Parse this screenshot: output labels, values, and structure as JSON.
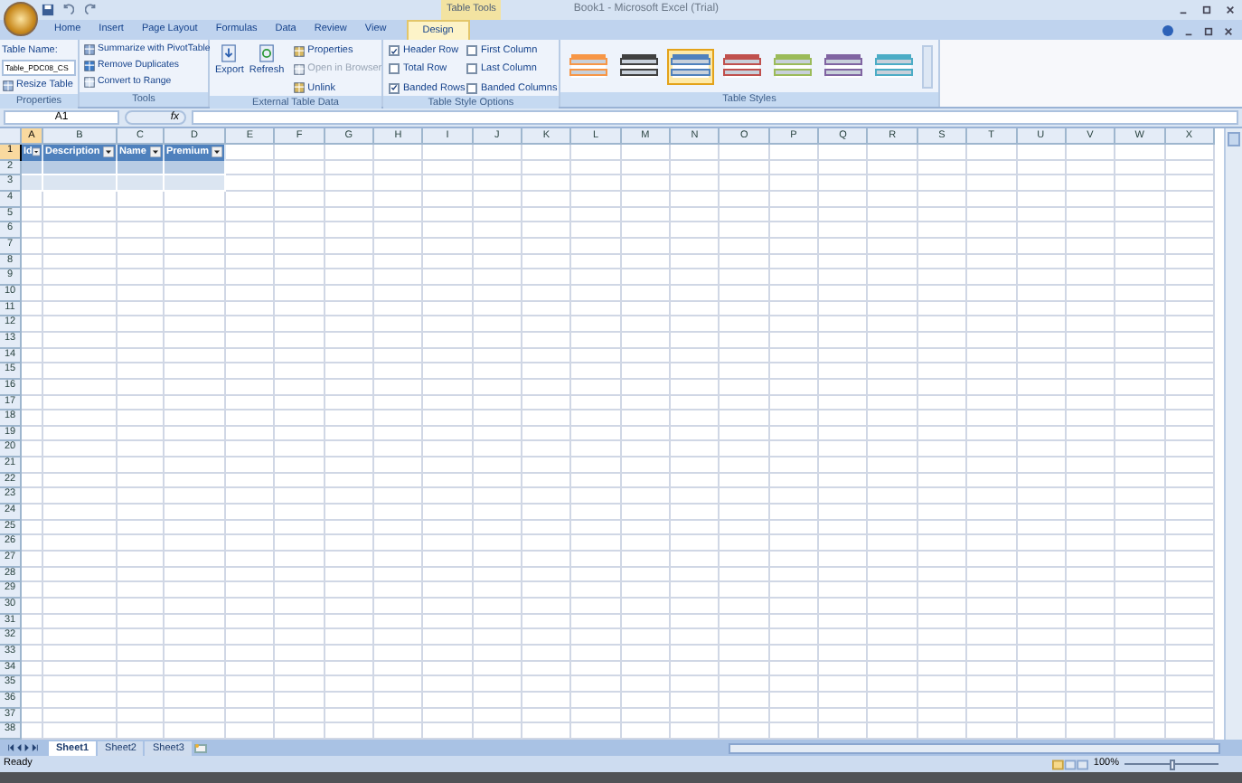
{
  "title_bar": {
    "context_label": "Table Tools",
    "title": "Book1 - Microsoft Excel (Trial)"
  },
  "tabs": [
    {
      "label": "Home",
      "selected": false
    },
    {
      "label": "Insert",
      "selected": false
    },
    {
      "label": "Page Layout",
      "selected": false
    },
    {
      "label": "Formulas",
      "selected": false
    },
    {
      "label": "Data",
      "selected": false
    },
    {
      "label": "Review",
      "selected": false
    },
    {
      "label": "View",
      "selected": false
    },
    {
      "label": "Design",
      "selected": true
    }
  ],
  "ribbon": {
    "properties": {
      "label": "Properties",
      "name_label": "Table Name:",
      "name_value": "Table_PDC08_CS",
      "resize": "Resize Table"
    },
    "tools": {
      "label": "Tools",
      "items": [
        "Summarize with PivotTable",
        "Remove Duplicates",
        "Convert to Range"
      ]
    },
    "external": {
      "label": "External Table Data",
      "large": [
        "Export",
        "Refresh"
      ],
      "items": [
        {
          "label": "Properties",
          "disabled": false
        },
        {
          "label": "Open in Browser",
          "disabled": true
        },
        {
          "label": "Unlink",
          "disabled": false
        }
      ]
    },
    "style_options": {
      "label": "Table Style Options",
      "options": [
        {
          "label": "Header Row",
          "checked": true
        },
        {
          "label": "Total Row",
          "checked": false
        },
        {
          "label": "Banded Rows",
          "checked": true
        },
        {
          "label": "First Column",
          "checked": false
        },
        {
          "label": "Last Column",
          "checked": false
        },
        {
          "label": "Banded Columns",
          "checked": false
        }
      ]
    },
    "table_styles": {
      "label": "Table Styles",
      "styles": [
        {
          "color": "#f79646",
          "selected": false
        },
        {
          "color": "#404040",
          "selected": false
        },
        {
          "color": "#4f81bd",
          "selected": true
        },
        {
          "color": "#c0504d",
          "selected": false
        },
        {
          "color": "#9bbb59",
          "selected": false
        },
        {
          "color": "#8064a2",
          "selected": false
        },
        {
          "color": "#4bacc6",
          "selected": false
        }
      ]
    }
  },
  "formula_bar": {
    "name_box": "A1",
    "function_label": "fx"
  },
  "columns": [
    {
      "label": "A",
      "selected": true
    },
    {
      "label": "B",
      "selected": false
    },
    {
      "label": "C",
      "selected": false
    },
    {
      "label": "D",
      "selected": false
    },
    {
      "label": "E",
      "selected": false
    },
    {
      "label": "F",
      "selected": false
    },
    {
      "label": "G",
      "selected": false
    },
    {
      "label": "H",
      "selected": false
    },
    {
      "label": "I",
      "selected": false
    },
    {
      "label": "J",
      "selected": false
    },
    {
      "label": "K",
      "selected": false
    },
    {
      "label": "L",
      "selected": false
    },
    {
      "label": "M",
      "selected": false
    },
    {
      "label": "N",
      "selected": false
    },
    {
      "label": "O",
      "selected": false
    },
    {
      "label": "P",
      "selected": false
    },
    {
      "label": "Q",
      "selected": false
    },
    {
      "label": "R",
      "selected": false
    },
    {
      "label": "S",
      "selected": false
    },
    {
      "label": "T",
      "selected": false
    },
    {
      "label": "U",
      "selected": false
    },
    {
      "label": "V",
      "selected": false
    },
    {
      "label": "W",
      "selected": false
    },
    {
      "label": "X",
      "selected": false
    }
  ],
  "rows": [
    {
      "label": "1",
      "selected": true
    },
    {
      "label": "2",
      "selected": false
    },
    {
      "label": "3",
      "selected": false
    },
    {
      "label": "4",
      "selected": false
    },
    {
      "label": "5",
      "selected": false
    },
    {
      "label": "6",
      "selected": false
    },
    {
      "label": "7",
      "selected": false
    },
    {
      "label": "8",
      "selected": false
    },
    {
      "label": "9",
      "selected": false
    },
    {
      "label": "10",
      "selected": false
    },
    {
      "label": "11",
      "selected": false
    },
    {
      "label": "12",
      "selected": false
    },
    {
      "label": "13",
      "selected": false
    },
    {
      "label": "14",
      "selected": false
    },
    {
      "label": "15",
      "selected": false
    },
    {
      "label": "16",
      "selected": false
    },
    {
      "label": "17",
      "selected": false
    },
    {
      "label": "18",
      "selected": false
    },
    {
      "label": "19",
      "selected": false
    },
    {
      "label": "20",
      "selected": false
    },
    {
      "label": "21",
      "selected": false
    },
    {
      "label": "22",
      "selected": false
    },
    {
      "label": "23",
      "selected": false
    },
    {
      "label": "24",
      "selected": false
    },
    {
      "label": "25",
      "selected": false
    },
    {
      "label": "26",
      "selected": false
    },
    {
      "label": "27",
      "selected": false
    },
    {
      "label": "28",
      "selected": false
    },
    {
      "label": "29",
      "selected": false
    },
    {
      "label": "30",
      "selected": false
    },
    {
      "label": "31",
      "selected": false
    },
    {
      "label": "32",
      "selected": false
    },
    {
      "label": "33",
      "selected": false
    },
    {
      "label": "34",
      "selected": false
    },
    {
      "label": "35",
      "selected": false
    },
    {
      "label": "36",
      "selected": false
    },
    {
      "label": "37",
      "selected": false
    },
    {
      "label": "38",
      "selected": false
    }
  ],
  "table": {
    "headers": [
      "Id",
      "Description",
      "Name",
      "Premium"
    ],
    "rows": [
      {
        "banded": true
      },
      {
        "banded": false
      }
    ]
  },
  "sheets": [
    {
      "label": "Sheet1",
      "selected": true
    },
    {
      "label": "Sheet2",
      "selected": false
    },
    {
      "label": "Sheet3",
      "selected": false
    }
  ],
  "status": "Ready",
  "zoom": "100%",
  "zoom_slider": {
    "level": 0.5
  }
}
